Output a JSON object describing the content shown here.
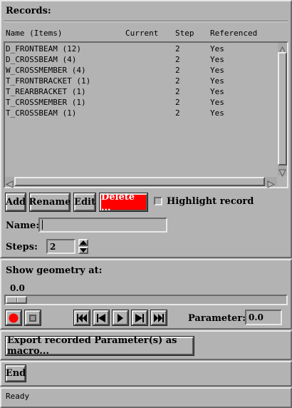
{
  "records": {
    "title": "Records:",
    "columns": [
      "Name (Items)",
      "Current",
      "Step",
      "Referenced"
    ],
    "rows": [
      {
        "name": "D_FRONTBEAM (12)",
        "current": "",
        "step": "2",
        "referenced": "Yes"
      },
      {
        "name": "D_CROSSBEAM (4)",
        "current": "",
        "step": "2",
        "referenced": "Yes"
      },
      {
        "name": "W_CROSSMEMBER (4)",
        "current": "",
        "step": "2",
        "referenced": "Yes"
      },
      {
        "name": "T_FRONTBRACKET (1)",
        "current": "",
        "step": "2",
        "referenced": "Yes"
      },
      {
        "name": "T_REARBRACKET (1)",
        "current": "",
        "step": "2",
        "referenced": "Yes"
      },
      {
        "name": "T_CROSSMEMBER (1)",
        "current": "",
        "step": "2",
        "referenced": "Yes"
      },
      {
        "name": "T_CROSSBEAM (1)",
        "current": "",
        "step": "2",
        "referenced": "Yes"
      }
    ],
    "buttons": {
      "add": "Add",
      "rename": "Rename",
      "edit": "Edit",
      "delete": "Delete ..."
    },
    "highlight_label": "Highlight record",
    "highlight_checked": false,
    "name_label": "Name:",
    "name_value": "",
    "steps_label": "Steps:",
    "steps_value": "2"
  },
  "geometry": {
    "title": "Show geometry at:",
    "slider_value": "0.0",
    "slider_fraction": 0.0,
    "parameter_label": "Parameter:",
    "parameter_value": "0.0"
  },
  "export_label": "Export recorded Parameter(s) as macro...",
  "end_label": "End",
  "status": "Ready",
  "colors": {
    "background": "#b3b3b3",
    "delete_button": "#ff0000",
    "record_dot": "#ff0000"
  }
}
